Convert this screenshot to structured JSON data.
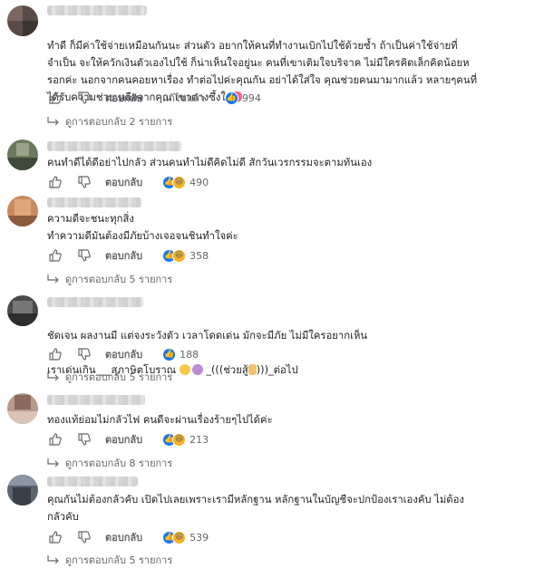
{
  "comments": [
    {
      "text": "ทำดี ก็มีค่าใช้จ่ายเหมือนกันนะ ส่วนตัว อยากให้คนที่ทำงานเบิกไปใช้ด้วยซ้ำ ถ้าเป็นค่าใช้จ่ายที่\nจำเป็น จะให้ควักเงินตัวเองไปใช้ ก็น่าเห็นใจอยู่นะ คนที่เขาเติมใจบริจาค ไม่มีใครคิดเล็กคิดน้อยห\nรอกค่ะ นอกจากคนคอยหาเรื่อง ทำต่อไปค่ะคุณกัน อย่าได้ใส่ใจ คุณช่วยคนมามากแล้ว หลายๆคนที่\nได้รับความช่วยเหลือจากคุณ เขาต่างซึ้งใจ",
      "reply_label": "ตอบกลับ",
      "edited_label": "แก้ไขแล้ว",
      "reaction_count": "994",
      "replies_label": "ดูการตอบกลับ 2 รายการ"
    },
    {
      "text": "คนทำดีได้ดีอย่าไปกลัว ส่วนคนทำไม่ดีคิดไม่ดี สักวันเวรกรรมจะตามทันเอง",
      "reply_label": "ตอบกลับ",
      "reaction_count": "490"
    },
    {
      "text": "ความดีจะชนะทุกสิ่ง\nทำความดีมันต้องมีภัยบ้างเจอจนชินทำใจค่ะ",
      "reply_label": "ตอบกลับ",
      "reaction_count": "358",
      "replies_label": "ดูการตอบกลับ 5 รายการ"
    },
    {
      "text_line1": "ชัดเจน ผลงานมี แต่จงระวังตัว เวลาโดดเด่น มักจะมีภัย ไม่มีใครอยากเห็น",
      "text_line2a": "เราเด่นเกิน___สุภาษิตโบราณ",
      "text_line2b": "_(((ช่วยสู้",
      "text_line2c": ")))_ต่อไป",
      "reply_label": "ตอบกลับ",
      "reaction_count": "188",
      "replies_label": "ดูการตอบกลับ 5 รายการ"
    },
    {
      "text": "ทองแท้ย่อมไม่กลัวไฟ คนดีจะผ่านเรื่องร้ายๆไปได้ค่ะ",
      "reply_label": "ตอบกลับ",
      "reaction_count": "213",
      "replies_label": "ดูการตอบกลับ 8 รายการ"
    },
    {
      "text": "คุณกันไม่ต้องกลัวคับ เปิดไปเลยเพราะเรามีหลักฐาน หลักฐานในบัญชีจะปกป้องเราเองคับ ไม่ต้อง\nกลัวคับ",
      "reply_label": "ตอบกลับ",
      "reaction_count": "539",
      "replies_label": "ดูการตอบกลับ 5 รายการ"
    }
  ],
  "colors": {
    "like": "#1877f2",
    "haha": "#f7b125",
    "love": "#f33e58",
    "meta": "#65676b"
  }
}
